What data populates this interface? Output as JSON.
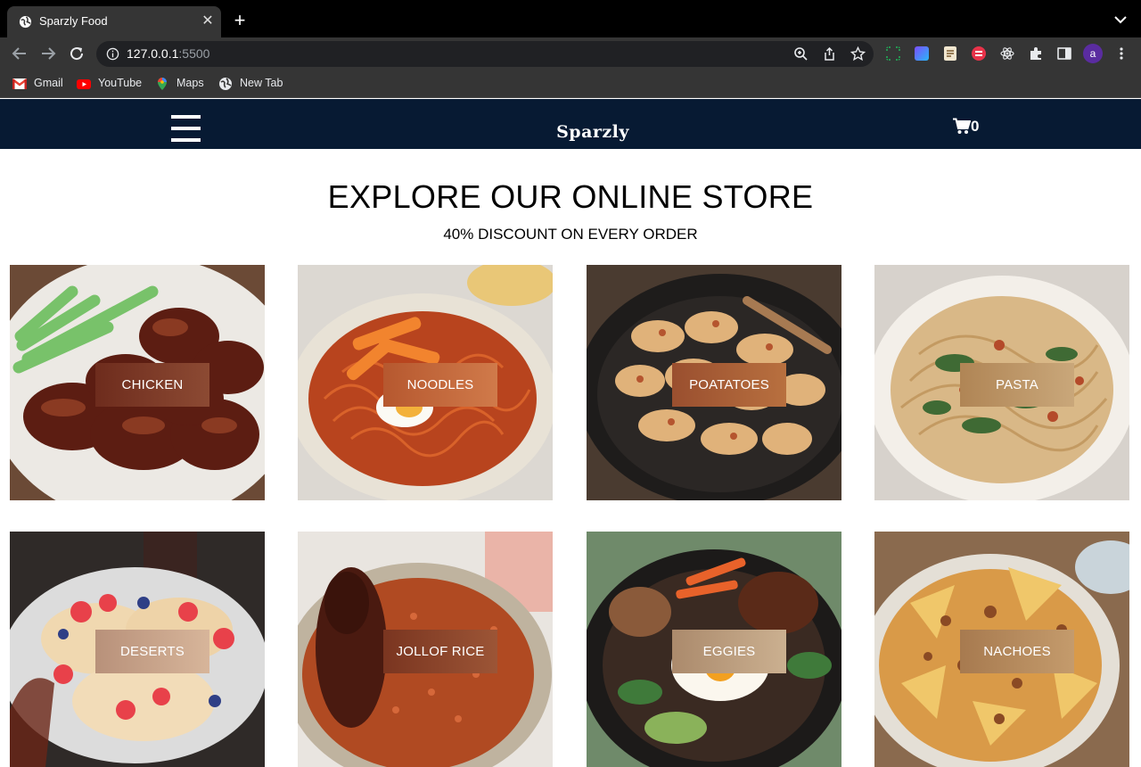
{
  "browser": {
    "tab_title": "Sparzly Food",
    "tab_close": "✕",
    "new_tab": "+",
    "url_host": "127.0.0.1",
    "url_port": ":5500",
    "profile_initial": "a",
    "bookmarks": [
      {
        "label": "Gmail",
        "icon": "gmail-icon"
      },
      {
        "label": "YouTube",
        "icon": "youtube-icon"
      },
      {
        "label": "Maps",
        "icon": "maps-icon"
      },
      {
        "label": "New Tab",
        "icon": "globe-icon"
      }
    ]
  },
  "site": {
    "logo": "Sparzly",
    "cart_count": "0",
    "hero_title": "EXPLORE OUR ONLINE STORE",
    "hero_subtitle": "40% DISCOUNT ON EVERY ORDER"
  },
  "products": [
    {
      "label": "CHICKEN",
      "accent": "#7a3322"
    },
    {
      "label": "NOODLES",
      "accent": "#c0673a"
    },
    {
      "label": "POATATOES",
      "accent": "#a65b38"
    },
    {
      "label": "PASTA",
      "accent": "#b89267"
    },
    {
      "label": "DESERTS",
      "accent": "#c9a282"
    },
    {
      "label": "JOLLOF RICE",
      "accent": "#8a4227"
    },
    {
      "label": "EGGIES",
      "accent": "#b99a7a"
    },
    {
      "label": "NACHOES",
      "accent": "#b88a5e"
    }
  ],
  "colors": {
    "nav_bg": "#071a33",
    "chrome_bg": "#353535",
    "tabbar_bg": "#000000"
  }
}
